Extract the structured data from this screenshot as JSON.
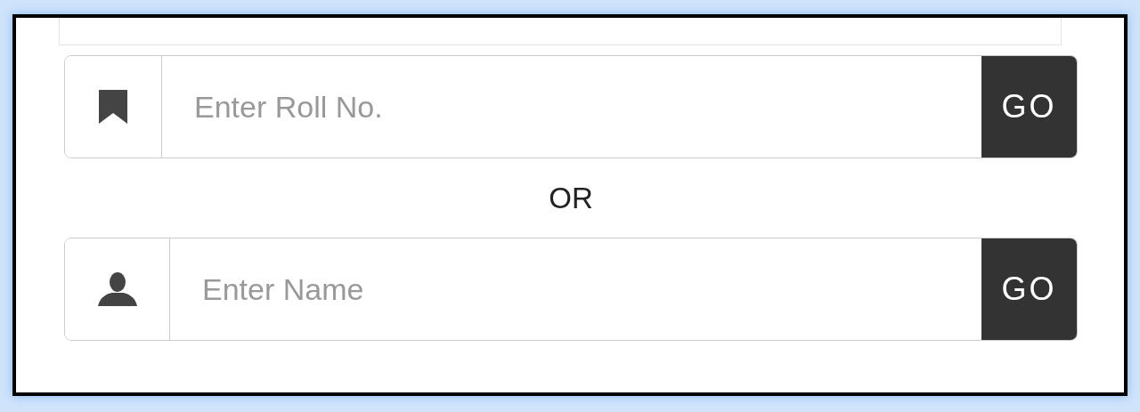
{
  "searches": [
    {
      "kind": "roll",
      "placeholder": "Enter Roll No.",
      "button": "GO"
    },
    {
      "kind": "name",
      "placeholder": "Enter Name",
      "button": "GO"
    }
  ],
  "separator": "OR"
}
